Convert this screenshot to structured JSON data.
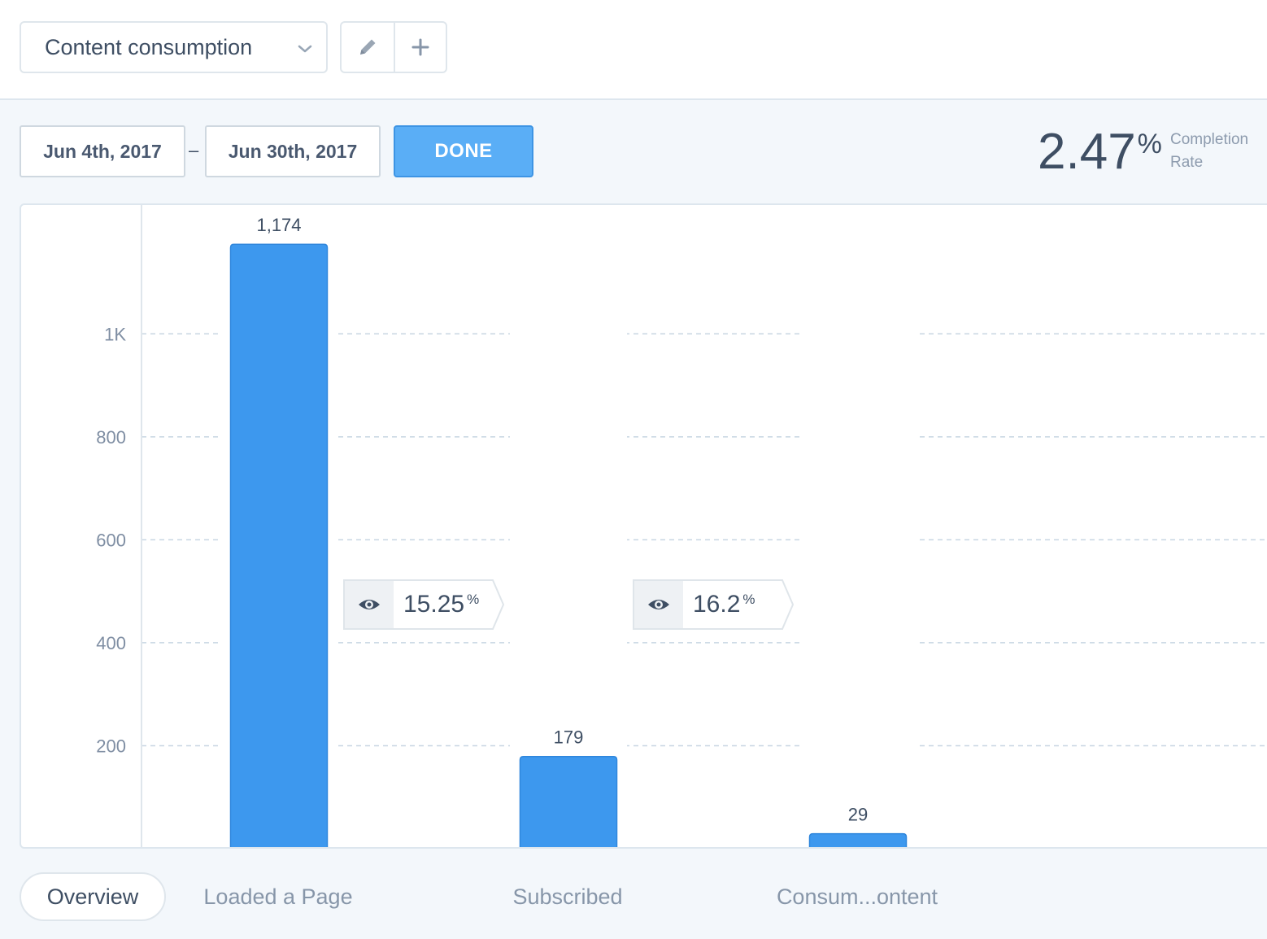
{
  "header": {
    "report_name": "Content consumption",
    "icons": {
      "dropdown": "chevron-down-icon",
      "edit": "pencil-icon",
      "add": "plus-icon"
    }
  },
  "date_range": {
    "start": "Jun 4th, 2017",
    "separator": "–",
    "end": "Jun 30th, 2017",
    "done_label": "DONE"
  },
  "completion": {
    "value": "2.47",
    "unit": "%",
    "label": "Completion Rate"
  },
  "conversions": [
    {
      "value": "15.25",
      "unit": "%",
      "icon": "eye-icon"
    },
    {
      "value": "16.2",
      "unit": "%",
      "icon": "eye-icon"
    }
  ],
  "tabs": [
    {
      "label": "Overview",
      "active": true
    },
    {
      "label": "Loaded a Page",
      "active": false
    },
    {
      "label": "Subscribed",
      "active": false
    },
    {
      "label": "Consum...ontent",
      "active": false
    }
  ],
  "colors": {
    "bar": "#3d98ee",
    "accent": "#5aaef6",
    "grid": "#c8d6e2"
  },
  "chart_data": {
    "type": "bar",
    "categories": [
      "Loaded a Page",
      "Subscribed",
      "Consum...ontent"
    ],
    "values": [
      1174,
      179,
      29
    ],
    "value_labels": [
      "1,174",
      "179",
      "29"
    ],
    "yticks": [
      200,
      400,
      600,
      800,
      1000
    ],
    "ytick_labels": [
      "200",
      "400",
      "600",
      "800",
      "1K"
    ],
    "ylim": [
      0,
      1250
    ],
    "grid": true
  }
}
